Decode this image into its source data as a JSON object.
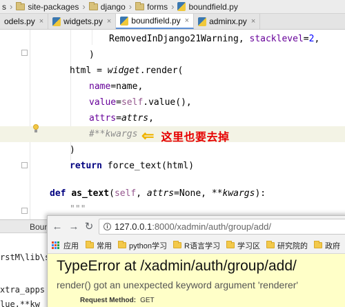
{
  "breadcrumb": [
    {
      "label": "s",
      "icon": "folder-icon"
    },
    {
      "label": "site-packages",
      "icon": "folder-icon"
    },
    {
      "label": "django",
      "icon": "folder-icon"
    },
    {
      "label": "forms",
      "icon": "folder-icon"
    },
    {
      "label": "boundfield.py",
      "icon": "python-file-icon"
    }
  ],
  "tabs": [
    {
      "label": "odels.py",
      "active": false
    },
    {
      "label": "widgets.py",
      "active": false
    },
    {
      "label": "boundfield.py",
      "active": true
    },
    {
      "label": "adminx.py",
      "active": false
    }
  ],
  "code": {
    "l1_a": "RemovedInDjango21Warning",
    "l1_b": ", ",
    "l1_c": "stacklevel",
    "l1_d": "=",
    "l1_e": "2",
    "l1_f": ",",
    "l2": ")",
    "l3_a": "html",
    "l3_b": " = ",
    "l3_c": "widget",
    "l3_d": ".render(",
    "l4_a": "name",
    "l4_b": "=name,",
    "l5_a": "value",
    "l5_b": "=",
    "l5_c": "self",
    "l5_d": ".value(),",
    "l6_a": "attrs",
    "l6_b": "=",
    "l6_c": "attrs",
    "l6_d": ",",
    "l7": "#**kwargs",
    "l8": ")",
    "l9_a": "return",
    "l9_b": " force_text(html)",
    "l10_a": "def",
    "l10_b": "as_text",
    "l10_c": "(",
    "l10_d": "self",
    "l10_e": ", ",
    "l10_f": "attrs",
    "l10_g": "=None, ",
    "l10_h": "**kwargs",
    "l10_i": "):",
    "l11": "\"\"\""
  },
  "annotation": {
    "arrow": "⇐",
    "text": "这里也要去掉"
  },
  "panel": {
    "title": "Boun"
  },
  "console": {
    "line1": "rstM\\lib\\s",
    "line2": "xtra_apps",
    "line3": "lue,**kw"
  },
  "browser": {
    "back": "←",
    "forward": "→",
    "reload": "↻",
    "info": "i",
    "url_host": "127.0.0.1",
    "url_path": ":8000/xadmin/auth/group/add/",
    "apps_label": "应用",
    "bookmarks": [
      "常用",
      "python学习",
      "R语言学习",
      "学习区",
      "研究院的",
      "政府"
    ],
    "error_title": "TypeError at /xadmin/auth/group/add/",
    "error_message": "render() got an unexpected keyword argument 'renderer'",
    "meta_label": "Request Method:",
    "meta_value": "GET"
  },
  "colors": {
    "keyword": "#000080",
    "param": "#660099",
    "self": "#94558d",
    "annotation": "#e60000",
    "arrow": "#f0b400",
    "error_bg": "#ffffc8"
  }
}
